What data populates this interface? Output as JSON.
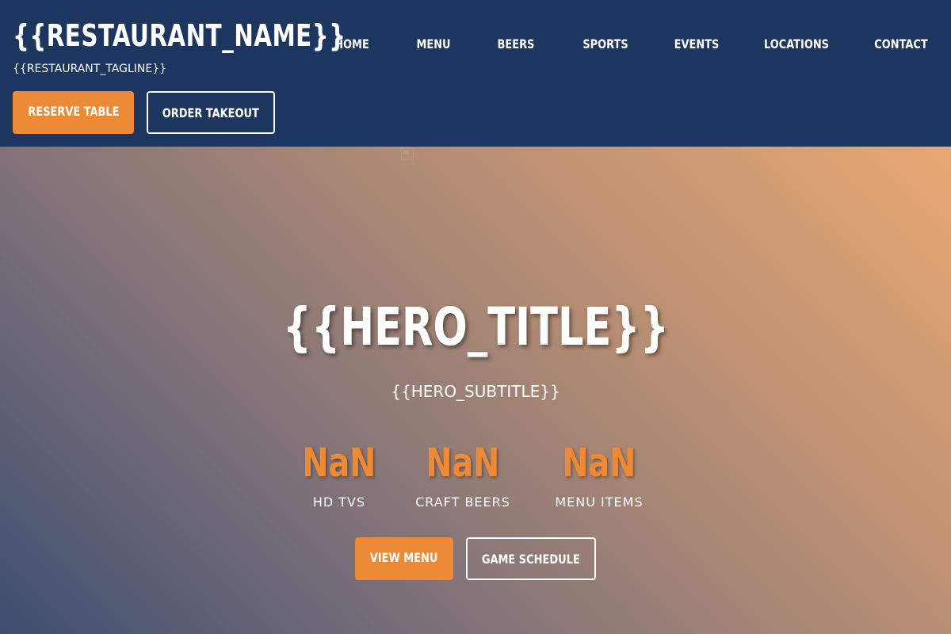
{
  "header": {
    "restaurant_name": "{{RESTAURANT_NAME}}",
    "restaurant_tagline": "{{RESTAURANT_TAGLINE}}",
    "nav": [
      {
        "label": "Home"
      },
      {
        "label": "Menu"
      },
      {
        "label": "Beers"
      },
      {
        "label": "Sports"
      },
      {
        "label": "Events"
      },
      {
        "label": "Locations"
      },
      {
        "label": "Contact"
      }
    ],
    "reserve_label": "Reserve Table",
    "takeout_label": "Order Takeout"
  },
  "hero": {
    "broken_image_icon": "broken-image-icon",
    "title": "{{HERO_TITLE}}",
    "subtitle": "{{HERO_SUBTITLE}}",
    "stats": [
      {
        "value": "NaN",
        "label": "HD TVs"
      },
      {
        "value": "NaN",
        "label": "Craft Beers"
      },
      {
        "value": "NaN",
        "label": "Menu Items"
      }
    ],
    "view_menu_label": "View Menu",
    "game_schedule_label": "Game Schedule"
  },
  "colors": {
    "header_bg": "#1c3660",
    "accent": "#ec8a35",
    "text": "#ffffff"
  }
}
